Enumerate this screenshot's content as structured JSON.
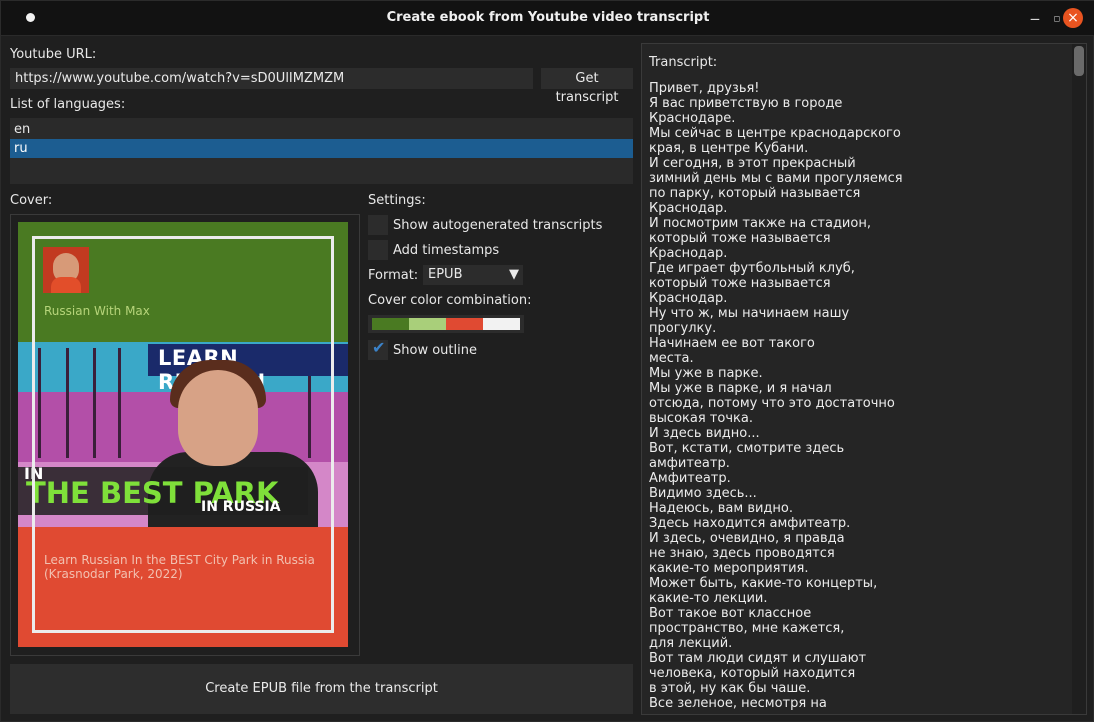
{
  "window": {
    "title": "Create ebook from Youtube video transcript",
    "minimize": "‒",
    "maximize": "◻",
    "close": "×"
  },
  "url": {
    "label": "Youtube URL:",
    "value": "https://www.youtube.com/watch?v=sD0UlIMZMZM",
    "get_button": "Get transcript"
  },
  "languages": {
    "label": "List of languages:",
    "items": [
      "en",
      "ru"
    ],
    "selected": "ru"
  },
  "cover": {
    "label": "Cover:",
    "author": "Russian With Max",
    "thumbnail_text_top": "LEARN RUSSIAN",
    "thumbnail_text_in": "IN",
    "thumbnail_text_main": "THE BEST PARK",
    "thumbnail_text_sub": "IN RUSSIA",
    "video_title": "Learn Russian In the BEST City Park in Russia (Krasnodar Park, 2022)"
  },
  "settings": {
    "label": "Settings:",
    "autogen_label": "Show autogenerated transcripts",
    "autogen_checked": false,
    "timestamps_label": "Add timestamps",
    "timestamps_checked": false,
    "format_label": "Format:",
    "format_value": "EPUB",
    "color_label": "Cover color combination:",
    "colors": [
      "#4a7a22",
      "#a9cf7a",
      "#e04a32",
      "#f2f2f2"
    ],
    "outline_label": "Show outline",
    "outline_checked": true
  },
  "create_button": "Create EPUB file from the transcript",
  "transcript": {
    "label": "Transcript:",
    "lines": [
      "Привет, друзья!",
      "Я вас приветствую в городе",
      "Краснодаре.",
      "Мы сейчас в центре краснодарского",
      "края, в центре Кубани.",
      "И сегодня, в этот прекрасный",
      "зимний день мы с вами прогуляемся",
      "по парку, который называется",
      "Краснодар.",
      "И посмотрим также на стадион,",
      "который тоже называется",
      "Краснодар.",
      "Где играет футбольный клуб,",
      "который тоже называется",
      "Краснодар.",
      "Ну что ж, мы начинаем нашу",
      "прогулку.",
      "Начинаем ее вот такого",
      "места.",
      "Мы уже в парке.",
      "Мы уже в парке, и я начал",
      "отсюда, потому что это достаточно",
      "высокая точка.",
      "И здесь видно...",
      "Вот, кстати, смотрите здесь",
      "амфитеатр.",
      "Амфитеатр.",
      "Видимо здесь...",
      "Надеюсь, вам видно.",
      "Здесь находится амфитеатр.",
      "И здесь, очевидно, я правда",
      "не знаю, здесь проводятся",
      "какие-то мероприятия.",
      "Может быть, какие-то концерты,",
      "какие-то лекции.",
      "Вот такое вот классное",
      "пространство, мне кажется,",
      "для лекций.",
      "Вот там люди сидят и слушают",
      "человека, который находится",
      "в этой, ну как бы чаше.",
      "Все зеленое, несмотря на"
    ]
  }
}
